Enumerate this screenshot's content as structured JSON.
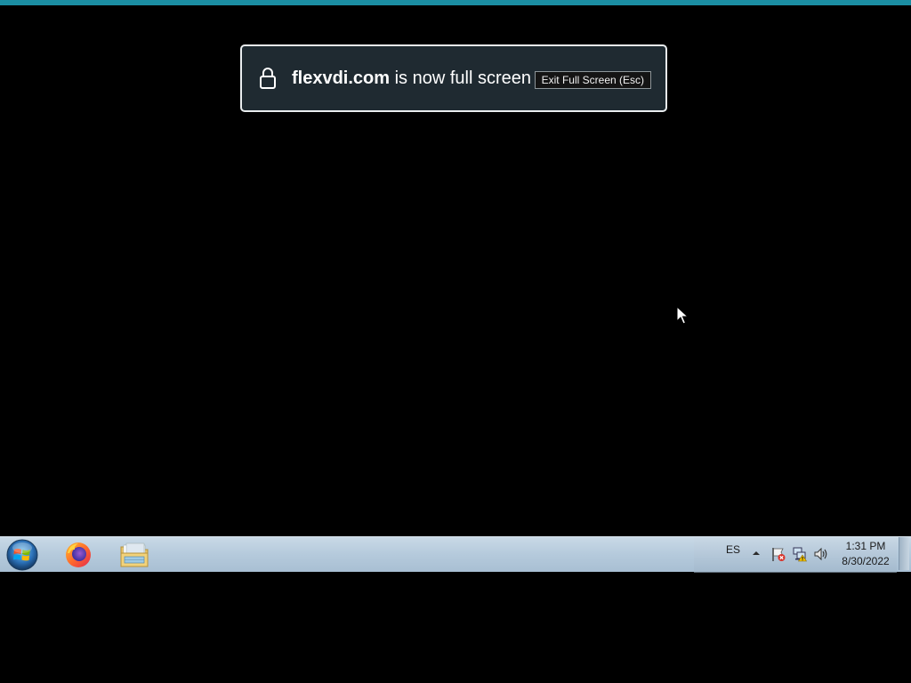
{
  "notification": {
    "domain": "flexvdi.com",
    "message": " is now full screen",
    "exit_button_label": "Exit Full Screen (Esc)",
    "lock_icon": "lock-icon"
  },
  "taskbar": {
    "start_icon": "windows-start-icon",
    "apps": [
      {
        "name": "Firefox",
        "icon": "firefox-icon"
      },
      {
        "name": "Windows Explorer",
        "icon": "folder-icon"
      }
    ],
    "tray": {
      "language": "ES",
      "icons": [
        "show-hidden-icons-arrow",
        "action-center-flag-icon",
        "network-icon",
        "volume-icon"
      ],
      "time": "1:31 PM",
      "date": "8/30/2022"
    }
  },
  "colors": {
    "top_strip": "#1b8ea3",
    "notice_bg": "#1f2a31",
    "taskbar": "#b5cadc"
  }
}
